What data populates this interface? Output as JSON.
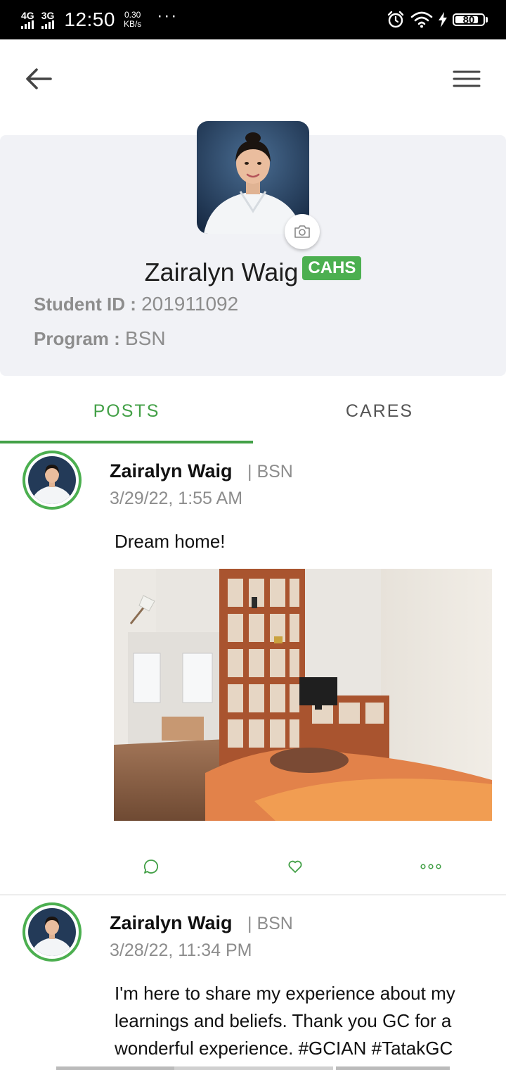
{
  "status_bar": {
    "network1": "4G",
    "network2": "3G",
    "time": "12:50",
    "speed_value": "0.30",
    "speed_unit": "KB/s",
    "more": "···",
    "battery": "80"
  },
  "profile": {
    "name": "Zairalyn Waig",
    "badge": "CAHS",
    "student_id_label": "Student ID : ",
    "student_id": "201911092",
    "program_label": "Program : ",
    "program": "BSN"
  },
  "tabs": [
    {
      "label": "POSTS"
    },
    {
      "label": "CARES"
    }
  ],
  "posts": [
    {
      "author": "Zairalyn Waig",
      "program": "| BSN",
      "timestamp": "3/29/22, 1:55 AM",
      "text": "Dream home!"
    },
    {
      "author": "Zairalyn Waig",
      "program": "| BSN",
      "timestamp": "3/28/22, 11:34 PM",
      "text": "I'm here to share my experience about my learnings and beliefs. Thank you GC for a wonderful experience. #GCIAN #TatakGC #CEAS"
    }
  ],
  "icons": {
    "back": "arrow-left-icon",
    "menu": "hamburger-menu-icon",
    "camera": "camera-icon",
    "comment": "comment-icon",
    "like": "heart-icon",
    "more": "more-dots-icon"
  },
  "colors": {
    "accent": "#43a047",
    "badge": "#4caf50",
    "card_bg": "#f1f2f6",
    "muted_text": "#8d8d8d"
  }
}
